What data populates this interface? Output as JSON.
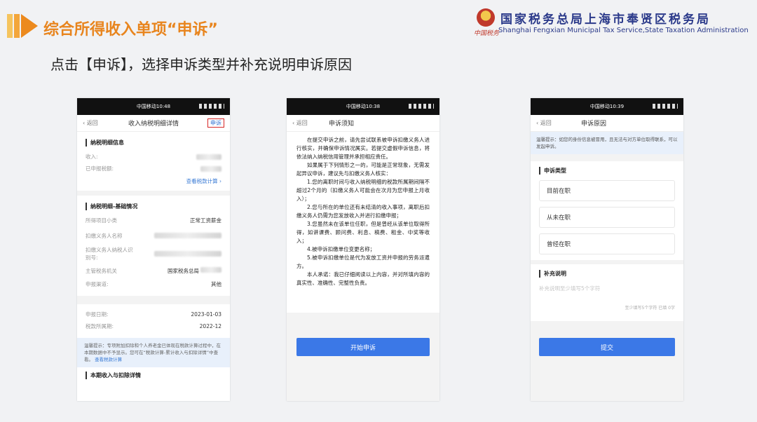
{
  "slide": {
    "title": "综合所得收入单项“申诉”",
    "instruction": "点击【申诉】，选择申诉类型并补充说明申诉原因",
    "org": {
      "name_cn": "国家税务总局上海市奉贤区税务局",
      "name_en": "Shanghai Fengxian Municipal Tax Service,State Taxation Administration",
      "signature": "中国税务"
    },
    "colors": {
      "title": "#e8851e",
      "org": "#2b3a8a",
      "accent_blue": "#3b78e7",
      "highlight_red": "#d72626"
    }
  },
  "phone1": {
    "status": "中国移动10:48",
    "back": "返回",
    "title": "收入纳税明细详情",
    "action": "申诉",
    "section1": {
      "title": "纳税明细信息",
      "rows": [
        {
          "label": "收入:",
          "value": ""
        },
        {
          "label": "已申报税额:",
          "value": ""
        }
      ],
      "link": "查看税款计算"
    },
    "section2": {
      "title": "纳税明细-基础情况",
      "rows": [
        {
          "label": "所得项目小类",
          "value": "正常工资薪金"
        },
        {
          "label": "扣缴义务人名称",
          "value": ""
        },
        {
          "label": "扣缴义务人纳税人识别号:",
          "value": ""
        },
        {
          "label": "主管税务机关",
          "value": "国家税务总局"
        },
        {
          "label": "申报渠道:",
          "value": "其他"
        }
      ]
    },
    "section3": {
      "rows": [
        {
          "label": "申报日期:",
          "value": "2023-01-03"
        },
        {
          "label": "税款所属期:",
          "value": "2022-12"
        }
      ]
    },
    "tip": {
      "text": "温馨提示：专项附加扣除和个人养老金已体现在税款计算过程中，在本期数据中不予显示。您可在“税款计算-累计收入与扣除详情”中查看。",
      "link": "查看税款计算"
    },
    "section4_title": "本期收入与扣除详情"
  },
  "phone2": {
    "status": "中国移动10:38",
    "back": "返回",
    "title": "申诉须知",
    "paragraphs": [
      "在提交申诉之前，请先尝试联系被申诉扣缴义务人进行核实，并确保申诉情况属实。若提交虚假申诉信息，将依法纳入纳税信用管理并承担相应责任。",
      "如果属于下列情形之一的，可能是正常现象，无需发起异议申诉，建议先与扣缴义务人核实：",
      "1.您的离职时间与收入纳税明细的税款所属期间隔不超过2个月的（扣缴义务人可能会在次月为您申报上月收入）；",
      "2.您与所在的单位还有未结清的收入事项，离职后扣缴义务人仍需为您发放收入并进行扣缴申报；",
      "3.您虽然未在该单位任职，但是曾经从该单位取得所得，如讲课费、顾问费、利息、稿费、租金、中奖等收入；",
      "4.被申诉扣缴单位变更名称；",
      "5.被申诉扣缴单位是代为发放工资并申报的劳务派遣方。",
      "本人承诺：我已仔细阅读以上内容，并对所填内容的真实性、准确性、完整性负责。"
    ],
    "button": "开始申诉"
  },
  "phone3": {
    "status": "中国移动10:39",
    "back": "返回",
    "title": "申诉原因",
    "warning": "温馨提示：如您的身份信息被冒用，且无法与对方单位取得联系，可以发起申诉。",
    "type_title": "申诉类型",
    "options": [
      "目前在职",
      "从未在职",
      "曾经在职"
    ],
    "note_title": "补充说明",
    "note_placeholder": "补充说明至少填写5个字符",
    "counter": "至少填写5个字符 已填 0字",
    "button": "提交"
  }
}
